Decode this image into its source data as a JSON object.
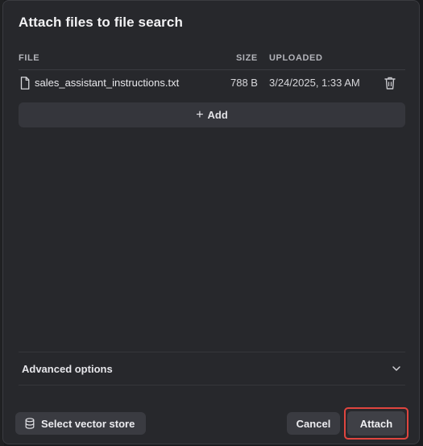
{
  "dialog": {
    "title": "Attach files to file search"
  },
  "table": {
    "columns": {
      "file": "FILE",
      "size": "SIZE",
      "uploaded": "UPLOADED"
    },
    "rows": [
      {
        "name": "sales_assistant_instructions.txt",
        "size": "788 B",
        "uploaded": "3/24/2025, 1:33 AM",
        "icon": "file-icon",
        "action_icon": "trash-icon"
      }
    ]
  },
  "add_button": {
    "icon": "plus-icon",
    "label": "Add"
  },
  "advanced": {
    "label": "Advanced options",
    "icon": "chevron-down-icon",
    "expanded": false
  },
  "footer": {
    "select_vector_store": {
      "icon": "database-icon",
      "label": "Select vector store"
    },
    "cancel_label": "Cancel",
    "attach_label": "Attach"
  },
  "colors": {
    "dialog_bg": "#27282c",
    "button_bg": "#3a3b41",
    "highlight_outline": "#e0453f"
  }
}
